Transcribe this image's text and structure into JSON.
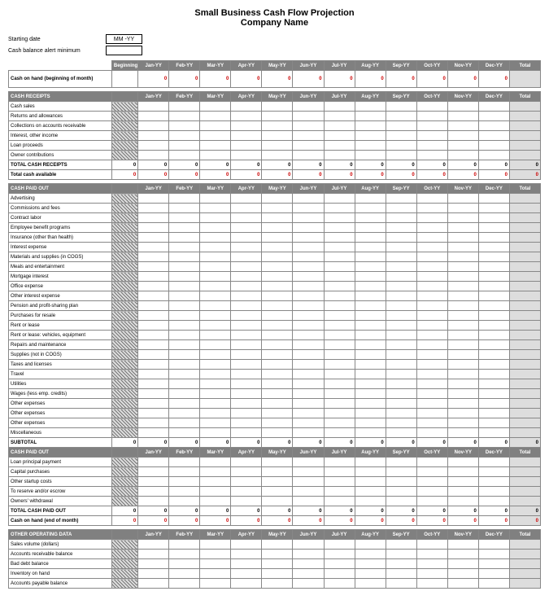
{
  "title": {
    "line1": "Small Business Cash Flow Projection",
    "line2": "Company Name"
  },
  "meta": {
    "starting_date_label": "Starting date",
    "starting_date_value": "MM -YY",
    "alert_label": "Cash balance alert minimum",
    "alert_value": ""
  },
  "months": [
    "Jan-YY",
    "Feb-YY",
    "Mar-YY",
    "Apr-YY",
    "May-YY",
    "Jun-YY",
    "Jul-YY",
    "Aug-YY",
    "Sep-YY",
    "Oct-YY",
    "Nov-YY",
    "Dec-YY"
  ],
  "beginning_label": "Beginning",
  "total_label": "Total",
  "cash_on_hand": {
    "label": "Cash on hand (beginning of month)",
    "beginning": "",
    "values": [
      "0",
      "0",
      "0",
      "0",
      "0",
      "0",
      "0",
      "0",
      "0",
      "0",
      "0",
      "0"
    ],
    "total": ""
  },
  "receipts": {
    "section_label": "CASH RECEIPTS",
    "rows": [
      "Cash sales",
      "Returns and allowances",
      "Collections on accounts receivable",
      "Interest, other income",
      "Loan proceeds",
      "Owner contributions"
    ],
    "total_row": {
      "label": "TOTAL CASH RECEIPTS",
      "values": [
        "0",
        "0",
        "0",
        "0",
        "0",
        "0",
        "0",
        "0",
        "0",
        "0",
        "0",
        "0",
        "0",
        "0"
      ]
    },
    "available_row": {
      "label": "Total cash available",
      "values": [
        "0",
        "0",
        "0",
        "0",
        "0",
        "0",
        "0",
        "0",
        "0",
        "0",
        "0",
        "0",
        "0",
        "0"
      ]
    }
  },
  "paid_out": {
    "section_label": "CASH PAID OUT",
    "rows": [
      "Advertising",
      "Commissions and fees",
      "Contract labor",
      "Employee benefit programs",
      "Insurance (other than health)",
      "Interest expense",
      "Materials and supplies (in COGS)",
      "Meals and entertainment",
      "Mortgage interest",
      "Office expense",
      "Other interest expense",
      "Pension and profit-sharing plan",
      "Purchases for resale",
      "Rent or lease",
      "Rent or lease: vehicles, equipment",
      "Repairs and maintenance",
      "Supplies (not in COGS)",
      "Taxes and licenses",
      "Travel",
      "Utilities",
      "Wages (less emp. credits)",
      "Other expenses",
      "Other expenses",
      "Other expenses",
      "Miscellaneous"
    ],
    "subtotal_row": {
      "label": "SUBTOTAL",
      "values": [
        "0",
        "0",
        "0",
        "0",
        "0",
        "0",
        "0",
        "0",
        "0",
        "0",
        "0",
        "0",
        "0",
        "0"
      ]
    },
    "repeat_label": "CASH PAID OUT",
    "extra_rows": [
      "Loan principal payment",
      "Capital purchases",
      "Other startup costs",
      "To reserve and/or escrow",
      "Owners' withdrawal"
    ],
    "total_row": {
      "label": "TOTAL CASH PAID OUT",
      "values": [
        "0",
        "0",
        "0",
        "0",
        "0",
        "0",
        "0",
        "0",
        "0",
        "0",
        "0",
        "0",
        "0",
        "0"
      ]
    },
    "end_row": {
      "label": "Cash on hand (end of month)",
      "values": [
        "0",
        "0",
        "0",
        "0",
        "0",
        "0",
        "0",
        "0",
        "0",
        "0",
        "0",
        "0",
        "0",
        "0"
      ]
    }
  },
  "other": {
    "section_label": "OTHER OPERATING DATA",
    "rows": [
      "Sales volume (dollars)",
      "Accounts receivable balance",
      "Bad debt balance",
      "Inventory on hand",
      "Accounts payable balance"
    ]
  }
}
